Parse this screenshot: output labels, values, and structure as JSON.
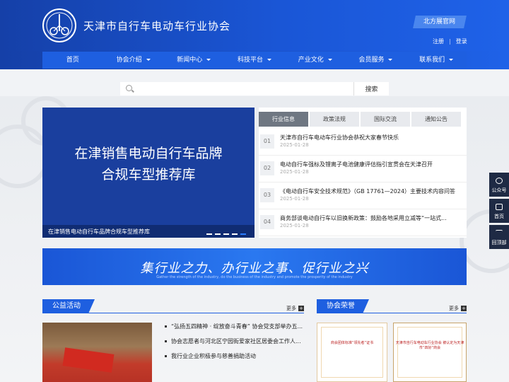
{
  "header": {
    "site_title": "天津市自行车电动车行业协会",
    "expo_label": "北方展官网",
    "register_label": "注册",
    "login_label": "登录"
  },
  "nav": {
    "items": [
      {
        "label": "首页",
        "dropdown": false
      },
      {
        "label": "协会介绍",
        "dropdown": true
      },
      {
        "label": "新闻中心",
        "dropdown": true
      },
      {
        "label": "科技平台",
        "dropdown": true
      },
      {
        "label": "产业文化",
        "dropdown": true
      },
      {
        "label": "会员服务",
        "dropdown": true
      },
      {
        "label": "联系我们",
        "dropdown": true
      }
    ]
  },
  "search": {
    "placeholder": "",
    "button_label": "搜索"
  },
  "banner": {
    "line1": "在津销售电动自行车品牌",
    "line2": "合规车型推荐库",
    "caption": "在津销售电动自行车品牌合规车型推荐库",
    "slide_count": 5,
    "active_slide": 5
  },
  "news": {
    "tabs": [
      "行业信息",
      "政策法规",
      "国际交流",
      "通知公告"
    ],
    "active_tab": 0,
    "items": [
      {
        "num": "01",
        "title": "天津市自行车电动车行业协会恭祝大家春节快乐",
        "date": "2025-01-28"
      },
      {
        "num": "02",
        "title": "电动自行车强标及锂离子电池健康评估指引宣贯会在天津召开",
        "date": "2025-01-28"
      },
      {
        "num": "03",
        "title": "《电动自行车安全技术规范》（GB 17761—2024）主要技术内容问答",
        "date": "2025-01-28"
      },
      {
        "num": "04",
        "title": "商务部谈电动自行车以旧换新政策：鼓励各地采用立减等“一站式...",
        "date": "2025-01-28"
      }
    ]
  },
  "slogan": {
    "main": "集行业之力、办行业之事、促行业之兴",
    "sub": "Gather the strength of the industry, do the business of the industry and promote the prosperity of the industry"
  },
  "welfare": {
    "title": "公益活动",
    "more_label": "更多",
    "items": [
      "“弘扬五四精神 · 绽放奋斗青春” 协会党支部举办五...",
      "协会志愿者与河北区宁园街爱家社区居委会工作人...",
      "我行业企业积极参与慈善捐助活动"
    ]
  },
  "honors": {
    "title": "协会荣誉",
    "more_label": "更多",
    "cert1_text": "商会团体标准“领先者”证书",
    "cert2_text": "天津市自行车电动车行业协会 被认定为天津市“四好”商会"
  },
  "sidebar": {
    "items": [
      "公众号",
      "首页",
      "回顶部"
    ]
  }
}
